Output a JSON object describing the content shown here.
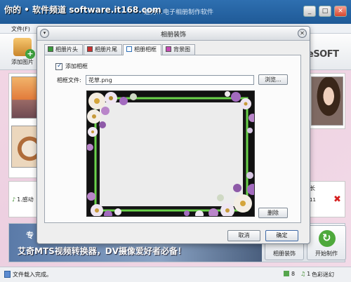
{
  "watermark": "你的 • 软件频道 software.it168.com",
  "app": {
    "title": "魅力…电子相册制作软件",
    "menu_file": "文件(F)",
    "add_photo_label": "添加图片",
    "brand": "eSOFT",
    "list_item": "1.感动",
    "list_header_length": "长",
    "list_item_length": "11",
    "ad_line1": "专",
    "ad_line2": "艾奇MTS视频转换器，DV摄像爱好者必备！",
    "decorate_button": "相册装饰",
    "make_button": "开始制作",
    "status_text": "文件载入完成。",
    "image_count": "8",
    "music_count": "1",
    "status_label": "色彩迷幻"
  },
  "dialog": {
    "title": "相册装饰",
    "tabs": [
      {
        "label": "相册片头"
      },
      {
        "label": "相册片尾"
      },
      {
        "label": "相册相框"
      },
      {
        "label": "背景图"
      }
    ],
    "active_tab": "相册相框",
    "add_frame_checkbox_label": "添加相框",
    "add_frame_checked": true,
    "frame_file_label": "相框文件:",
    "frame_file_value": "花草.png",
    "browse_button": "浏览...",
    "delete_button": "删除",
    "cancel_button": "取消",
    "ok_button": "确定"
  },
  "colors": {
    "frame_border": "#6ad24a",
    "frame_background": "#111111",
    "title_bar": "#2e6fb0"
  }
}
